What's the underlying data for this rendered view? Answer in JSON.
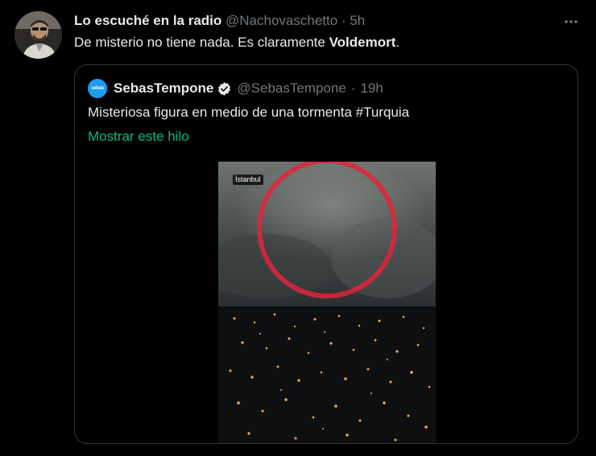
{
  "tweet": {
    "author_name": "Lo escuché en la radio",
    "handle": "@Nachovaschetto",
    "separator": "·",
    "time": "5h",
    "text_prefix": "De misterio no tiene nada. Es claramente ",
    "text_bold": "Voldemort",
    "text_suffix": ".",
    "more_icon": "more-horizontal-icon"
  },
  "quoted_tweet": {
    "avatar_text": "sebas",
    "author_name": "SebasTempone",
    "verified_icon": "verified-badge-icon",
    "handle": "@SebasTempone",
    "separator": "·",
    "time": "19h",
    "text": "Misteriosa figura en medio de una tormenta #Turquia",
    "show_thread": "Mostrar este hilo",
    "media": {
      "label": "İstanbul",
      "description_icon": "storm-video-thumbnail"
    }
  },
  "colors": {
    "background": "#000000",
    "text": "#e7e9ea",
    "secondary": "#71767b",
    "border": "#2f3336",
    "link_green": "#00ba7c",
    "verified_blue": "#1d9bf0",
    "circle_red": "#e0243c"
  }
}
